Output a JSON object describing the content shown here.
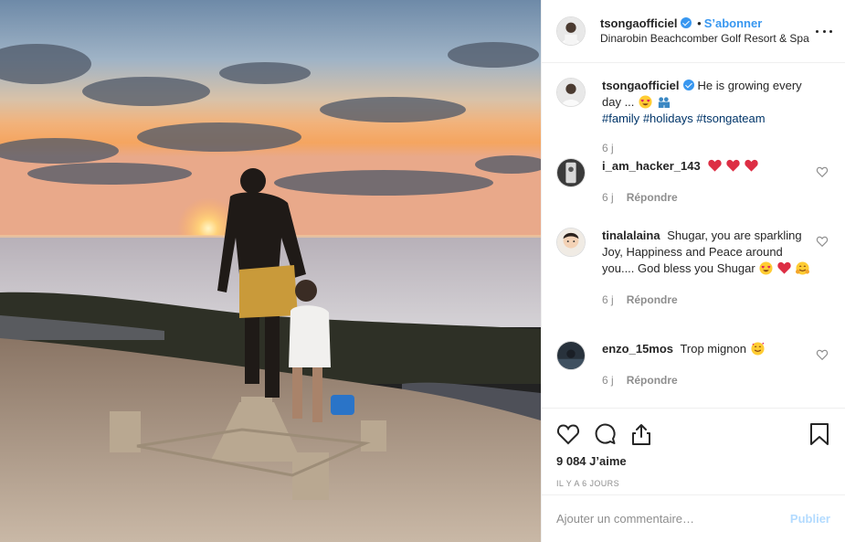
{
  "post": {
    "author": "tsongaofficiel",
    "follow_label": "S’abonner",
    "separator": "•",
    "location": "Dinarobin Beachcomber Golf Resort & Spa",
    "caption_text": "He is growing every day ...",
    "hashtags": [
      "#family",
      "#holidays",
      "#tsongateam"
    ],
    "caption_age": "6 j",
    "likes": "9 084 J’aime",
    "posted": "IL Y A 6 JOURS"
  },
  "comments": [
    {
      "user": "i_am_hacker_143",
      "text": "",
      "age": "6 j",
      "reply": "Répondre",
      "emojis": [
        "red-heart",
        "red-heart",
        "red-heart"
      ]
    },
    {
      "user": "tinalalaina",
      "text": "Shugar, you are sparkling Joy, Happiness and Peace around you.... God bless you Shugar",
      "age": "6 j",
      "reply": "Répondre",
      "emojis": [
        "heart-eyes",
        "red-heart",
        "hugging"
      ]
    },
    {
      "user": "enzo_15mos",
      "text": "Trop mignon",
      "age": "6 j",
      "reply": "Répondre",
      "emojis": [
        "smiling-hearts"
      ]
    }
  ],
  "add_comment": {
    "placeholder": "Ajouter un commentaire…",
    "post_label": "Publier"
  },
  "icons": {
    "like": "heart-outline-icon",
    "comment": "comment-icon",
    "share": "share-icon",
    "save": "bookmark-icon",
    "more": "more-options-icon",
    "verified": "verified-badge-icon"
  },
  "colors": {
    "link_blue": "#3897f0",
    "hashtag": "#003569",
    "muted": "#8e8e8e",
    "post_disabled": "#b3dbff"
  }
}
